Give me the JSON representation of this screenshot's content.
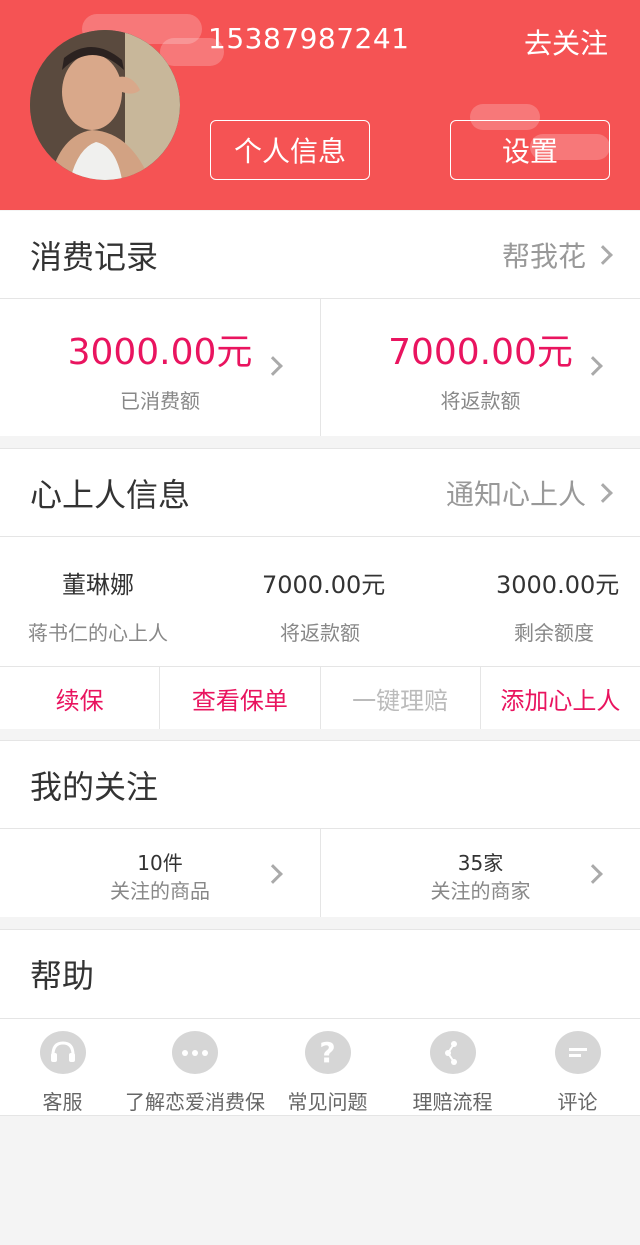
{
  "header": {
    "phone": "15387987241",
    "follow_label": "去关注",
    "profile_button": "个人信息",
    "settings_button": "设置"
  },
  "consumption": {
    "title": "消费记录",
    "action": "帮我花",
    "spent_amount": "3000.00元",
    "spent_label": "已消费额",
    "refund_amount": "7000.00元",
    "refund_label": "将返款额"
  },
  "sweetheart": {
    "title": "心上人信息",
    "action": "通知心上人",
    "name": "董琳娜",
    "name_label": "蒋书仁的心上人",
    "refund_amount": "7000.00元",
    "refund_label": "将返款额",
    "remaining_amount": "3000.00元",
    "remaining_label": "剩余额度",
    "actions": [
      "续保",
      "查看保单",
      "一键理赔",
      "添加心上人"
    ]
  },
  "follow": {
    "title": "我的关注",
    "goods_count": "10件",
    "goods_label": "关注的商品",
    "shops_count": "35家",
    "shops_label": "关注的商家"
  },
  "help": {
    "title": "帮助"
  },
  "tabbar": {
    "items": [
      {
        "label": "客服",
        "icon": "headset-icon"
      },
      {
        "label": "了解恋爱消费保",
        "icon": "more-dots-icon"
      },
      {
        "label": "常见问题",
        "icon": "question-icon"
      },
      {
        "label": "理赔流程",
        "icon": "flow-icon"
      },
      {
        "label": "评论",
        "icon": "comment-icon"
      }
    ]
  },
  "colors": {
    "header_bg": "#f55354",
    "accent": "#e9145f"
  }
}
